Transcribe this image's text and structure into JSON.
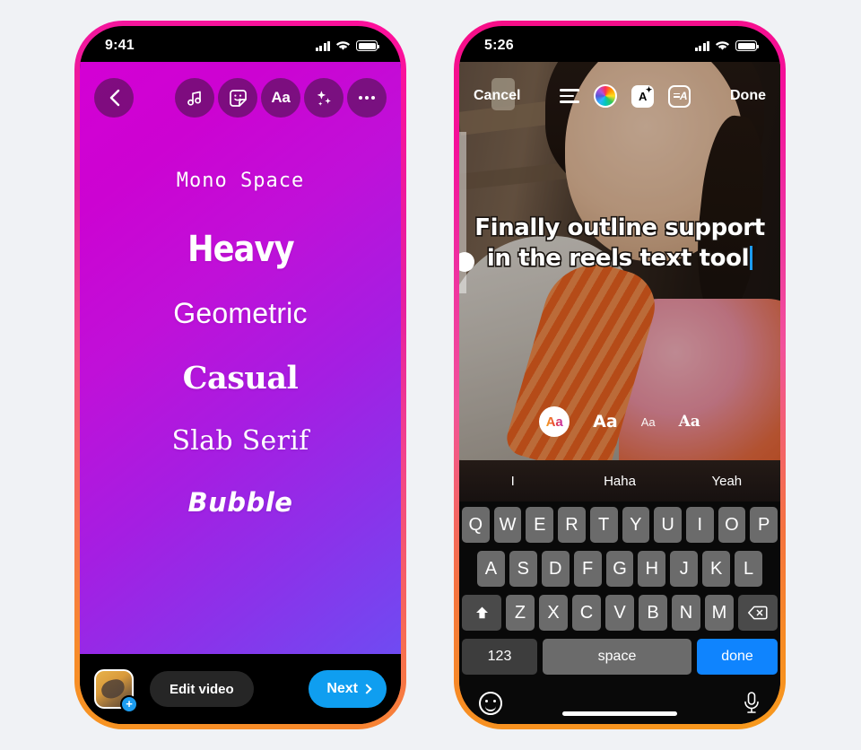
{
  "page": {
    "background": "#f0f2f5"
  },
  "left_phone": {
    "frame_gradient": [
      "#ff0f9b",
      "#f79520"
    ],
    "status_bar": {
      "time": "9:41",
      "signal_icon": "signal-bars-icon",
      "wifi_icon": "wifi-icon",
      "battery_icon": "battery-icon"
    },
    "toolbar": {
      "back_icon": "chevron-left-icon",
      "tools": [
        {
          "name": "music-icon",
          "glyph": "♫"
        },
        {
          "name": "sticker-icon",
          "glyph": "☺"
        },
        {
          "name": "text-icon",
          "label": "Aa"
        },
        {
          "name": "sparkles-icon",
          "glyph": "✦"
        },
        {
          "name": "more-icon",
          "glyph": "…"
        }
      ]
    },
    "canvas": {
      "gradient_from": "#d400d4",
      "gradient_to": "#6f4bf2",
      "font_options": [
        {
          "label": "Mono Space",
          "style": "mono"
        },
        {
          "label": "Heavy",
          "style": "heavy"
        },
        {
          "label": "Geometric",
          "style": "geometric"
        },
        {
          "label": "Casual",
          "style": "casual"
        },
        {
          "label": "Slab Serif",
          "style": "slab"
        },
        {
          "label": "Bubble",
          "style": "bubble"
        }
      ]
    },
    "bottom_bar": {
      "thumbnail_name": "media-thumbnail",
      "add_badge": "+",
      "edit_label": "Edit video",
      "next_label": "Next",
      "next_color": "#0f9ef0"
    }
  },
  "right_phone": {
    "frame_gradient": [
      "#f70e86",
      "#f79a1c"
    ],
    "status_bar": {
      "time": "5:26",
      "signal_icon": "signal-bars-icon",
      "wifi_icon": "wifi-icon",
      "battery_icon": "battery-icon"
    },
    "edit_toolbar": {
      "cancel_label": "Cancel",
      "done_label": "Done",
      "align_icon": "text-align-icon",
      "color_icon": "color-wheel-icon",
      "effects_label": "A",
      "effects_icon": "text-effects-icon",
      "outline_label": "A",
      "outline_icon": "text-outline-icon"
    },
    "overlay_text": {
      "line1": "Finally outline support",
      "line2": "in the reels text tool",
      "fill_color": "#ffffff",
      "outline_color": "#1a1410",
      "caret_color": "#1c9cf0"
    },
    "font_chips": [
      {
        "label": "Aa",
        "selected": true
      },
      {
        "label": "Aa",
        "selected": false
      },
      {
        "label": "Aa",
        "selected": false
      },
      {
        "label": "Aa",
        "selected": false
      }
    ],
    "keyboard": {
      "suggestions": [
        "I",
        "Haha",
        "Yeah"
      ],
      "row1": [
        "Q",
        "W",
        "E",
        "R",
        "T",
        "Y",
        "U",
        "I",
        "O",
        "P"
      ],
      "row2": [
        "A",
        "S",
        "D",
        "F",
        "G",
        "H",
        "J",
        "K",
        "L"
      ],
      "row3_shift_icon": "shift-icon",
      "row3": [
        "Z",
        "X",
        "C",
        "V",
        "B",
        "N",
        "M"
      ],
      "row3_delete_icon": "backspace-icon",
      "numbers_label": "123",
      "space_label": "space",
      "done_label": "done",
      "done_color": "#0f84fe",
      "emoji_icon": "emoji-icon",
      "mic_icon": "microphone-icon"
    }
  }
}
